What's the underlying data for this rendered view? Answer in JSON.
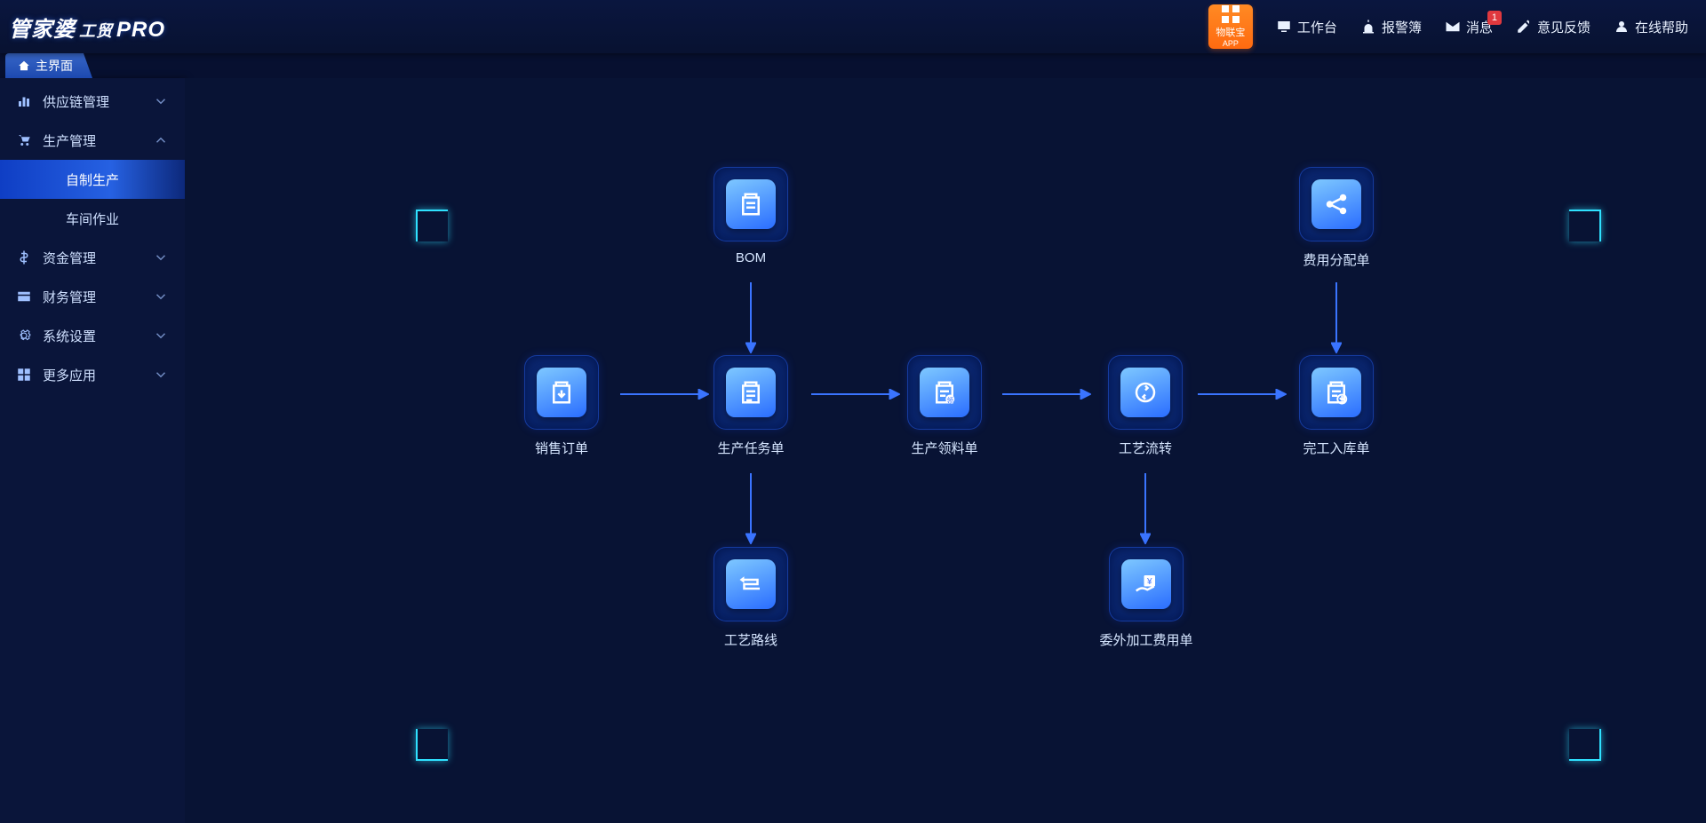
{
  "brand": {
    "name": "管家婆",
    "suite": "工贸",
    "edition": "PRO"
  },
  "topbar": {
    "app_badge_label": "物联宝",
    "app_badge_sub": "APP",
    "links": {
      "workbench": "工作台",
      "alarms": "报警簿",
      "messages": "消息",
      "messages_badge": "1",
      "feedback": "意见反馈",
      "help": "在线帮助"
    }
  },
  "tab": {
    "label": "主界面"
  },
  "sidebar": {
    "cats": [
      {
        "label": "供应链管理"
      },
      {
        "label": "生产管理"
      },
      {
        "label": "资金管理"
      },
      {
        "label": "财务管理"
      },
      {
        "label": "系统设置"
      },
      {
        "label": "更多应用"
      }
    ],
    "subs": {
      "self_prod": "自制生产",
      "workshop": "车间作业"
    }
  },
  "flow": {
    "bom": "BOM",
    "sales_order": "销售订单",
    "prod_task": "生产任务单",
    "prod_pick": "生产领料单",
    "process_flow": "工艺流转",
    "finish_in": "完工入库单",
    "expense_alloc": "费用分配单",
    "process_route": "工艺路线",
    "outsource_fee": "委外加工费用单"
  }
}
